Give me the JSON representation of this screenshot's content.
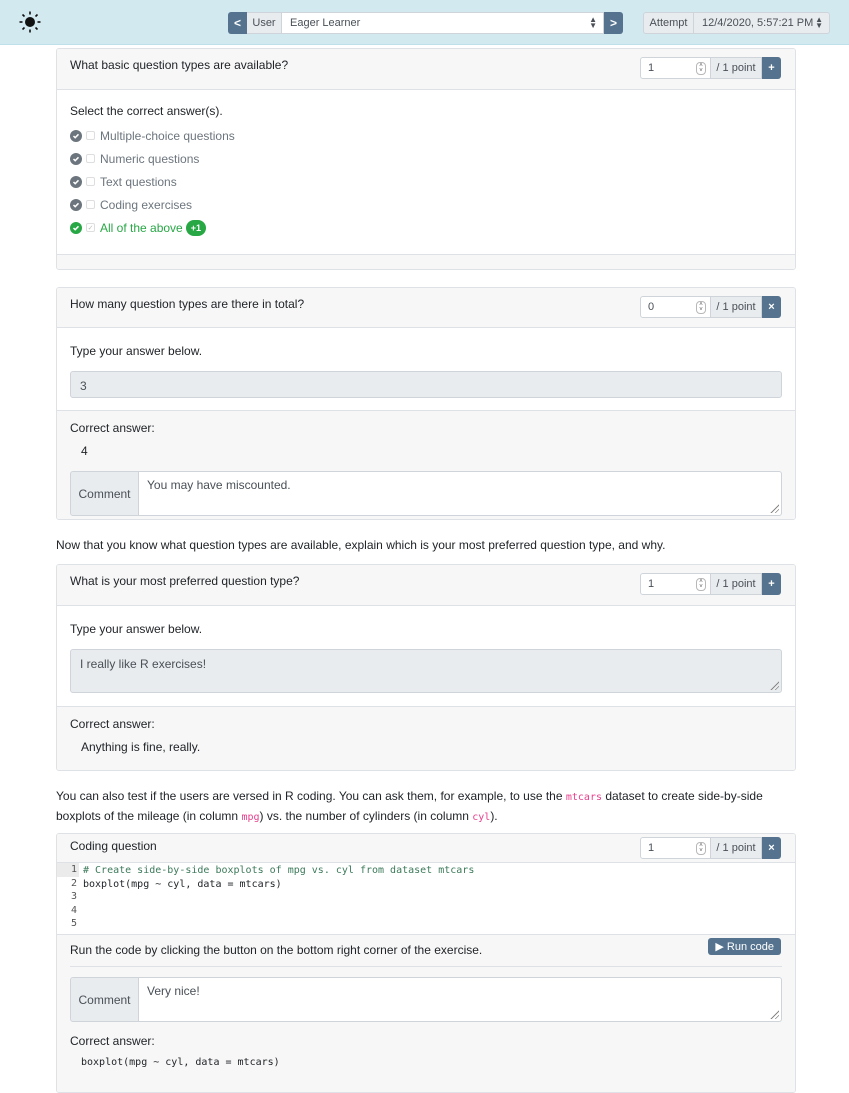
{
  "topbar": {
    "theme_icon": "sun-icon",
    "prev_label": "<",
    "next_label": ">",
    "user_label": "User",
    "user_value": "Eager Learner",
    "attempt_label": "Attempt",
    "attempt_value": "12/4/2020, 5:57:21 PM"
  },
  "q1": {
    "title": "What basic question types are available?",
    "points_value": "1",
    "points_label": "/ 1 point",
    "points_button": "+",
    "instructions": "Select the correct answer(s).",
    "choices": [
      {
        "label": "Multiple-choice questions",
        "checked": false,
        "correct": false
      },
      {
        "label": "Numeric questions",
        "checked": false,
        "correct": false
      },
      {
        "label": "Text questions",
        "checked": false,
        "correct": false
      },
      {
        "label": "Coding exercises",
        "checked": false,
        "correct": false
      },
      {
        "label": "All of the above",
        "checked": true,
        "correct": true,
        "badge": "+1"
      }
    ]
  },
  "q2": {
    "title": "How many question types are there in total?",
    "points_value": "0",
    "points_label": "/ 1 point",
    "points_button": "×",
    "instructions": "Type your answer below.",
    "answer": "3",
    "correct_title": "Correct answer:",
    "correct_value": "4",
    "comment_label": "Comment",
    "comment": "You may have miscounted."
  },
  "para1": "Now that you know what question types are available, explain which is your most preferred question type, and why.",
  "q3": {
    "title": "What is your most preferred question type?",
    "points_value": "1",
    "points_label": "/ 1 point",
    "points_button": "+",
    "instructions": "Type your answer below.",
    "answer": "I really like R exercises!",
    "correct_title": "Correct answer:",
    "correct_value": "Anything is fine, really."
  },
  "para2": {
    "part1": "You can also test if the users are versed in R coding. You can ask them, for example, to use the ",
    "code1": "mtcars",
    "part2": " dataset to create side-by-side boxplots of the mileage (in column ",
    "code2": "mpg",
    "part3": ") vs. the number of cylinders (in column ",
    "code3": "cyl",
    "part4": ")."
  },
  "q4": {
    "title": "Coding question",
    "points_value": "1",
    "points_label": "/ 1 point",
    "points_button": "×",
    "line_numbers": [
      "1",
      "2",
      "3",
      "4",
      "5"
    ],
    "code_lines": [
      "# Create side-by-side boxplots of mpg vs. cyl from dataset mtcars",
      "boxplot(mpg ~ cyl, data = mtcars)",
      "",
      "",
      ""
    ],
    "run_instructions": "Run the code by clicking the button on the bottom right corner of the exercise.",
    "run_button": "▶ Run code",
    "comment_label": "Comment",
    "comment": "Very nice!",
    "correct_title": "Correct answer:",
    "correct_value": "boxplot(mpg ~ cyl, data = mtcars)"
  }
}
